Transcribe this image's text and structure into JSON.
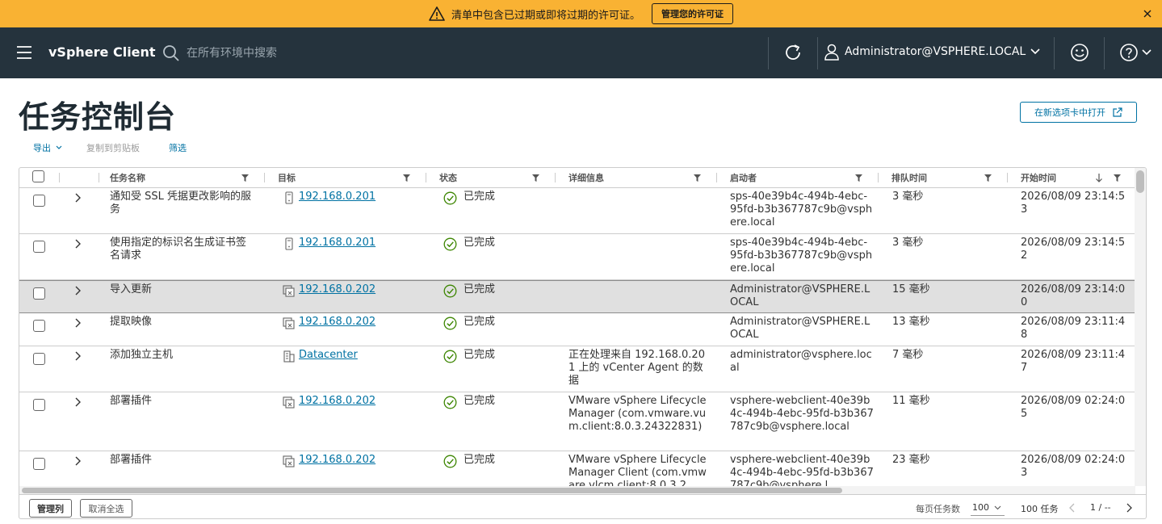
{
  "banner": {
    "message": "清单中包含已过期或即将过期的许可证。",
    "button_label": "管理您的许可证"
  },
  "header": {
    "app_title": "vSphere Client",
    "search_placeholder": "在所有环境中搜索",
    "user": "Administrator@VSPHERE.LOCAL",
    "bg_color": "#25333d"
  },
  "page": {
    "title": "任务控制台",
    "open_new_tab": "在新选项卡中打开"
  },
  "toolbar": {
    "export": "导出",
    "copy": "复制到剪贴板",
    "filter": "筛选"
  },
  "columns": [
    "任务名称",
    "目标",
    "状态",
    "详细信息",
    "启动者",
    "排队时间",
    "开始时间"
  ],
  "rows": [
    {
      "name": "通知受 SSL 凭据更改影响的服务",
      "target_icon": "host-icon",
      "target": "192.168.0.201",
      "status": "已完成",
      "detail": "",
      "initiator": "sps-40e39b4c-494b-4ebc-95fd-b3b367787c9b@vsphere.local",
      "queued": "3 毫秒",
      "start": "2026/08/09 23:14:53"
    },
    {
      "name": "使用指定的标识名生成证书签名请求",
      "target_icon": "host-icon",
      "target": "192.168.0.201",
      "status": "已完成",
      "detail": "",
      "initiator": "sps-40e39b4c-494b-4ebc-95fd-b3b367787c9b@vsphere.local",
      "queued": "3 毫秒",
      "start": "2026/08/09 23:14:52"
    },
    {
      "name": "导入更新",
      "target_icon": "vcenter-icon",
      "target": "192.168.0.202",
      "status": "已完成",
      "detail": "",
      "initiator": "Administrator@VSPHERE.LOCAL",
      "queued": "15 毫秒",
      "start": "2026/08/09 23:14:00",
      "selected": true
    },
    {
      "name": "提取映像",
      "target_icon": "vcenter-icon",
      "target": "192.168.0.202",
      "status": "已完成",
      "detail": "",
      "initiator": "Administrator@VSPHERE.LOCAL",
      "queued": "13 毫秒",
      "start": "2026/08/09 23:11:48"
    },
    {
      "name": "添加独立主机",
      "target_icon": "datacenter-icon",
      "target": "Datacenter",
      "status": "已完成",
      "detail": "正在处理来自 192.168.0.201 上的 vCenter Agent 的数据",
      "initiator": "administrator@vsphere.local",
      "queued": "7 毫秒",
      "start": "2026/08/09 23:11:47"
    },
    {
      "name": "部署插件",
      "target_icon": "vcenter-icon",
      "target": "192.168.0.202",
      "status": "已完成",
      "detail": "VMware vSphere Lifecycle Manager (com.vmware.vum.client:8.0.3.24322831)",
      "initiator": "vsphere-webclient-40e39b4c-494b-4ebc-95fd-b3b367787c9b@vsphere.local",
      "queued": "11 毫秒",
      "start": "2026/08/09 02:24:05"
    },
    {
      "name": "部署插件",
      "target_icon": "vcenter-icon",
      "target": "192.168.0.202",
      "status": "已完成",
      "detail": "VMware vSphere Lifecycle Manager Client (com.vmware.vlcm.client:8.0.3.2",
      "initiator": "vsphere-webclient-40e39b4c-494b-4ebc-95fd-b3b367787c9b@vsphere.l",
      "queued": "23 毫秒",
      "start": "2026/08/09 02:24:03"
    }
  ],
  "footer": {
    "manage_columns": "管理列",
    "deselect_all": "取消全选",
    "per_page_label": "每页任务数",
    "per_page_value": "100",
    "task_count": "100 任务",
    "page": "1 / --"
  },
  "colors": {
    "banner": "#f9b233",
    "link": "#0072a3",
    "success": "#3c8500"
  }
}
